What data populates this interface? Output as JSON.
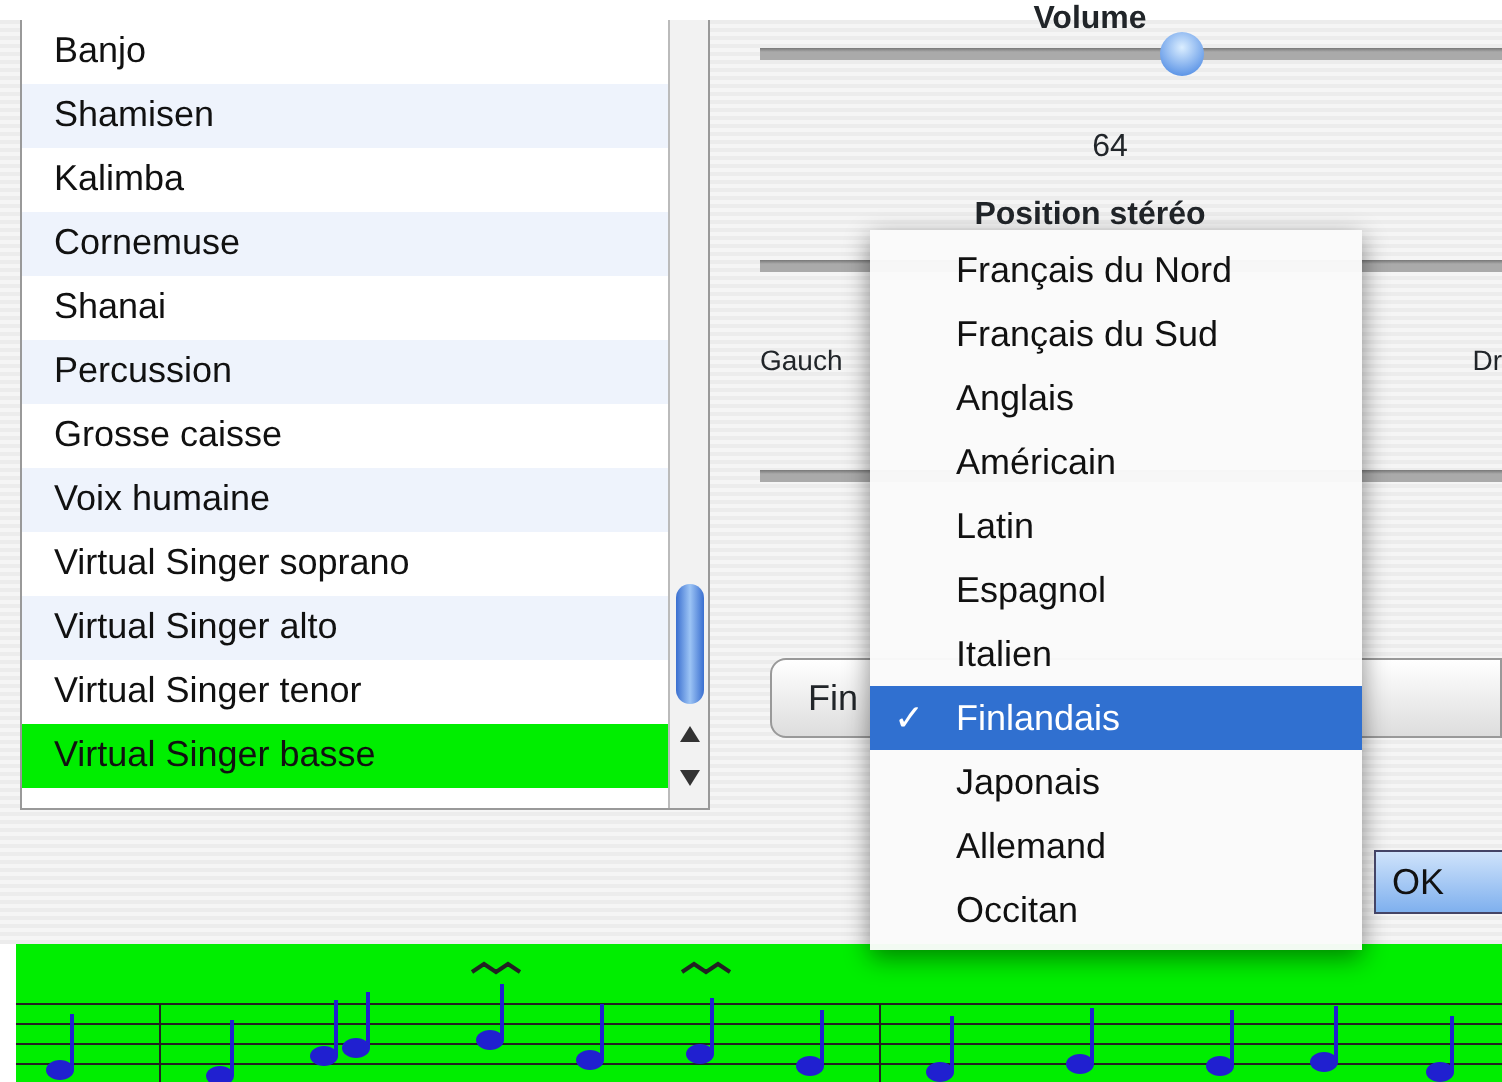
{
  "instruments": [
    {
      "name": "Banjo",
      "selected": false
    },
    {
      "name": "Shamisen",
      "selected": false
    },
    {
      "name": "Kalimba",
      "selected": false
    },
    {
      "name": "Cornemuse",
      "selected": false
    },
    {
      "name": "Shanai",
      "selected": false
    },
    {
      "name": "Percussion",
      "selected": false
    },
    {
      "name": "Grosse caisse",
      "selected": false
    },
    {
      "name": "Voix humaine",
      "selected": false
    },
    {
      "name": "Virtual Singer soprano",
      "selected": false
    },
    {
      "name": "Virtual Singer alto",
      "selected": false
    },
    {
      "name": "Virtual Singer tenor",
      "selected": false
    },
    {
      "name": "Virtual Singer basse",
      "selected": true
    }
  ],
  "volume": {
    "title": "Volume",
    "level": 0.57,
    "reading": "64"
  },
  "stereo": {
    "title": "Position stéréo",
    "left_label": "Gauch",
    "right_label": "Dr"
  },
  "language_popup": {
    "value": "Fin"
  },
  "language_menu": [
    {
      "label": "Français du Nord",
      "selected": false
    },
    {
      "label": "Français du Sud",
      "selected": false
    },
    {
      "label": "Anglais",
      "selected": false
    },
    {
      "label": "Américain",
      "selected": false
    },
    {
      "label": "Latin",
      "selected": false
    },
    {
      "label": "Espagnol",
      "selected": false
    },
    {
      "label": "Italien",
      "selected": false
    },
    {
      "label": "Finlandais",
      "selected": true,
      "check": "✓"
    },
    {
      "label": "Japonais",
      "selected": false
    },
    {
      "label": "Allemand",
      "selected": false
    },
    {
      "label": "Occitan",
      "selected": false
    }
  ],
  "buttons": [
    {
      "label": "OK",
      "default": true
    }
  ]
}
